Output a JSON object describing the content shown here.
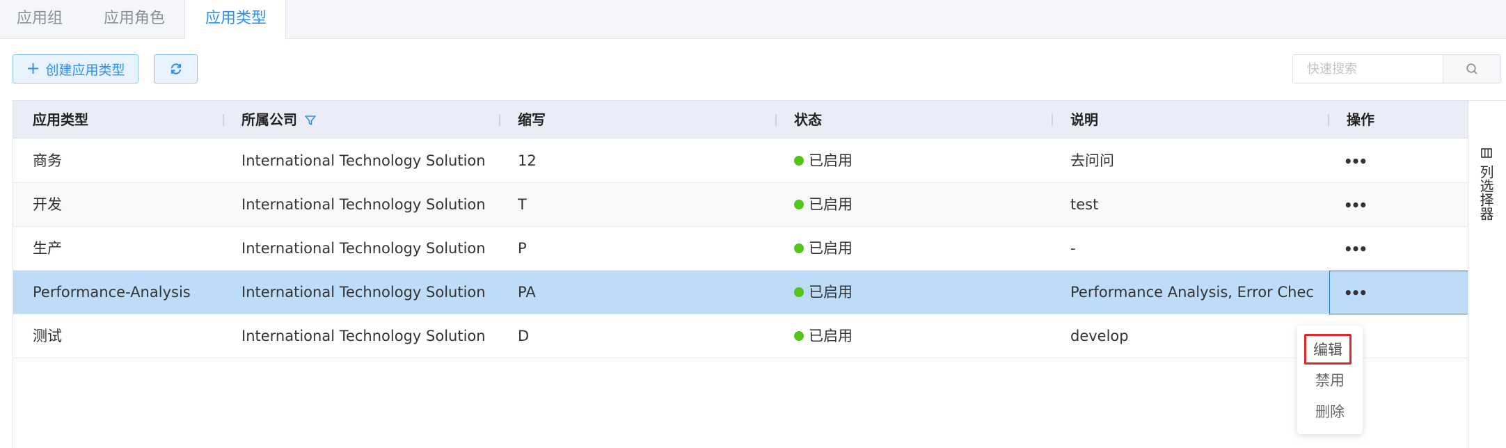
{
  "tabs": [
    {
      "label": "应用组",
      "active": false
    },
    {
      "label": "应用角色",
      "active": false
    },
    {
      "label": "应用类型",
      "active": true
    }
  ],
  "toolbar": {
    "create_label": "创建应用类型",
    "refresh_icon": "refresh-icon",
    "search_placeholder": "快速搜索",
    "search_icon": "search-icon"
  },
  "table": {
    "columns": [
      "应用类型",
      "所属公司",
      "缩写",
      "状态",
      "说明",
      "操作"
    ],
    "filter_icon_column": "所属公司",
    "rows": [
      {
        "type": "商务",
        "company": "International Technology Solution ...",
        "abbr": "12",
        "status": "已启用",
        "desc": "去问问",
        "action": "•••"
      },
      {
        "type": "开发",
        "company": "International Technology Solution ...",
        "abbr": "T",
        "status": "已启用",
        "desc": "test",
        "action": "•••"
      },
      {
        "type": "生产",
        "company": "International Technology Solution ...",
        "abbr": "P",
        "status": "已启用",
        "desc": "-",
        "action": "•••"
      },
      {
        "type": "Performance-Analysis",
        "company": "International Technology Solution ...",
        "abbr": "PA",
        "status": "已启用",
        "desc": "Performance Analysis, Error Checki...",
        "action": "•••",
        "selected": true
      },
      {
        "type": "测试",
        "company": "International Technology Solution ...",
        "abbr": "D",
        "status": "已启用",
        "desc": "develop",
        "action": "•••"
      }
    ]
  },
  "column_selector": {
    "label": "列选择器",
    "icon": "columns-icon"
  },
  "action_menu": {
    "items": [
      "编辑",
      "禁用",
      "删除"
    ],
    "highlighted": "编辑"
  },
  "colors": {
    "accent": "#2a8ff7",
    "status_enabled": "#52c41a",
    "selected_row": "#bcdcf8",
    "header_bg": "#eaedf7",
    "highlight_border": "#e02a2a"
  }
}
